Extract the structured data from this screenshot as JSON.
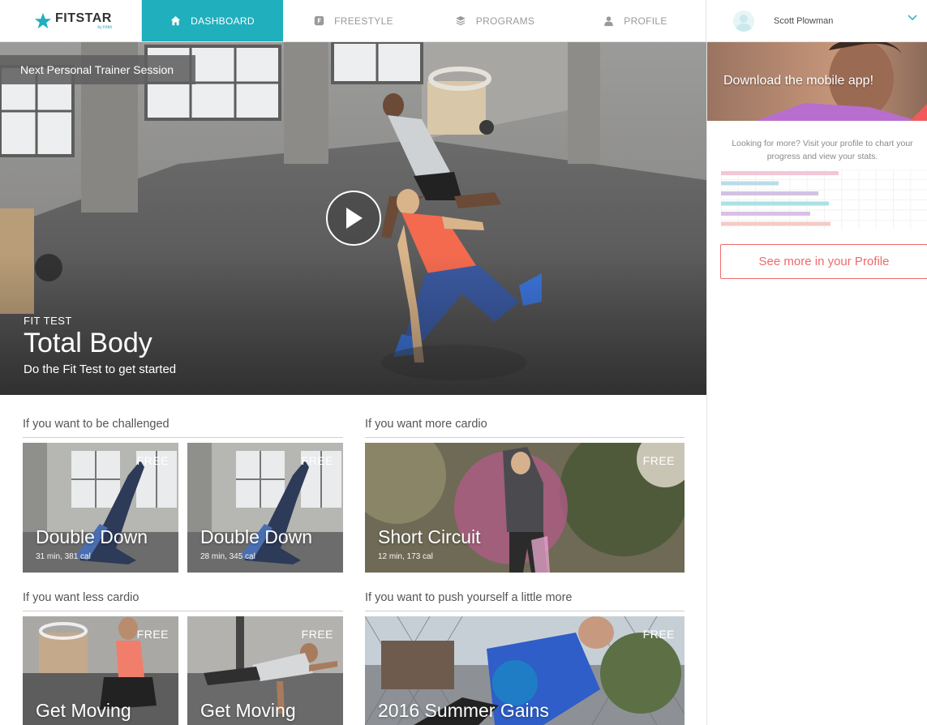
{
  "app": {
    "brand": "FITSTAR",
    "brand_sub": "by Fitbit"
  },
  "nav": {
    "tabs": [
      {
        "label": "DASHBOARD",
        "icon": "home-icon",
        "active": true
      },
      {
        "label": "FREESTYLE",
        "icon": "freestyle-icon",
        "active": false
      },
      {
        "label": "PROGRAMS",
        "icon": "layers-icon",
        "active": false
      },
      {
        "label": "PROFILE",
        "icon": "person-icon",
        "active": false
      }
    ],
    "user_name": "Scott Plowman"
  },
  "hero": {
    "session_label": "Next Personal Trainer Session",
    "eyebrow": "FIT TEST",
    "title": "Total Body",
    "subtitle": "Do the Fit Test to get started"
  },
  "sidebar": {
    "promo_text": "Download the mobile app!",
    "copy": "Looking for more? Visit your profile to chart your progress and view your stats.",
    "button_label": "See more in your Profile",
    "stat_bars": [
      {
        "value": 0.57,
        "color": "#f3c6d8"
      },
      {
        "value": 0.28,
        "color": "#b9dce8"
      },
      {
        "value": 0.47,
        "color": "#cfc3e3"
      },
      {
        "value": 0.52,
        "color": "#a9e2e4"
      },
      {
        "value": 0.43,
        "color": "#dcbfe6"
      },
      {
        "value": 0.53,
        "color": "#f7c9c6"
      }
    ]
  },
  "sections": [
    {
      "title": "If you want to be challenged",
      "cards": [
        {
          "title": "Double Down",
          "meta": "31 min, 381 cal",
          "badge": "FREE"
        },
        {
          "title": "Double Down",
          "meta": "28 min, 345 cal",
          "badge": "FREE"
        }
      ]
    },
    {
      "title": "If you want more cardio",
      "cards": [
        {
          "title": "Short Circuit",
          "meta": "12 min, 173 cal",
          "badge": "FREE"
        }
      ]
    },
    {
      "title": "If you want less cardio",
      "cards": [
        {
          "title": "Get Moving",
          "meta": "",
          "badge": "FREE"
        },
        {
          "title": "Get Moving",
          "meta": "",
          "badge": "FREE"
        }
      ]
    },
    {
      "title": "If you want to push yourself a little more",
      "cards": [
        {
          "title": "2016 Summer Gains",
          "meta": "",
          "badge": "FREE"
        }
      ]
    }
  ]
}
